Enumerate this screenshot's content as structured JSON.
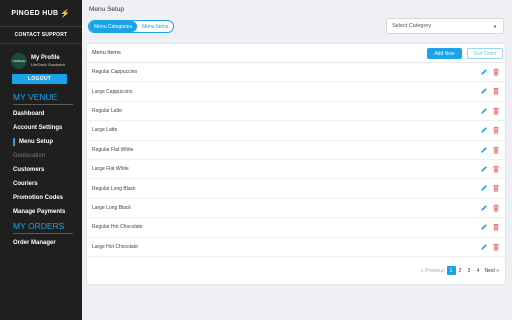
{
  "sidebar": {
    "brand": "PINGED HUB",
    "contact": "CONTACT SUPPORT",
    "profile_name": "My Profile",
    "profile_sub": "LifeDash Sandwich",
    "avatar_text": "LifeDash",
    "logout": "LOGOUT",
    "venue_heading": "MY VENUE",
    "venue_items": [
      "Dashboard",
      "Account Settings",
      "Menu Setup",
      "Geolocation",
      "Customers",
      "Couriers",
      "Promotion Codes",
      "Manage Payments"
    ],
    "orders_heading": "MY ORDERS",
    "orders_items": [
      "Order Manager"
    ]
  },
  "main": {
    "title": "Menu Setup",
    "tabs": [
      "Menu Categories",
      "Menu Items"
    ],
    "select_placeholder": "Select Category",
    "card_title": "Menu Items",
    "add_button": "Add New",
    "sort_button": "Sort Order",
    "items": [
      "Regular Cappuccino",
      "Large Cappuccino",
      "Regular Latte",
      "Large Latte",
      "Regular Flat White",
      "Large Flat White",
      "Regular Long Black",
      "Large Long Black",
      "Regular Hot Chocolate",
      "Large Hot Chocolate"
    ],
    "pagination": {
      "prev": "« Previous",
      "pages": [
        "1",
        "2",
        "3",
        "4"
      ],
      "current": "1",
      "next": "Next »"
    }
  },
  "colors": {
    "accent": "#1aa3e8",
    "delete": "#e05a5a",
    "sidebar_bg": "#1f1f20"
  }
}
